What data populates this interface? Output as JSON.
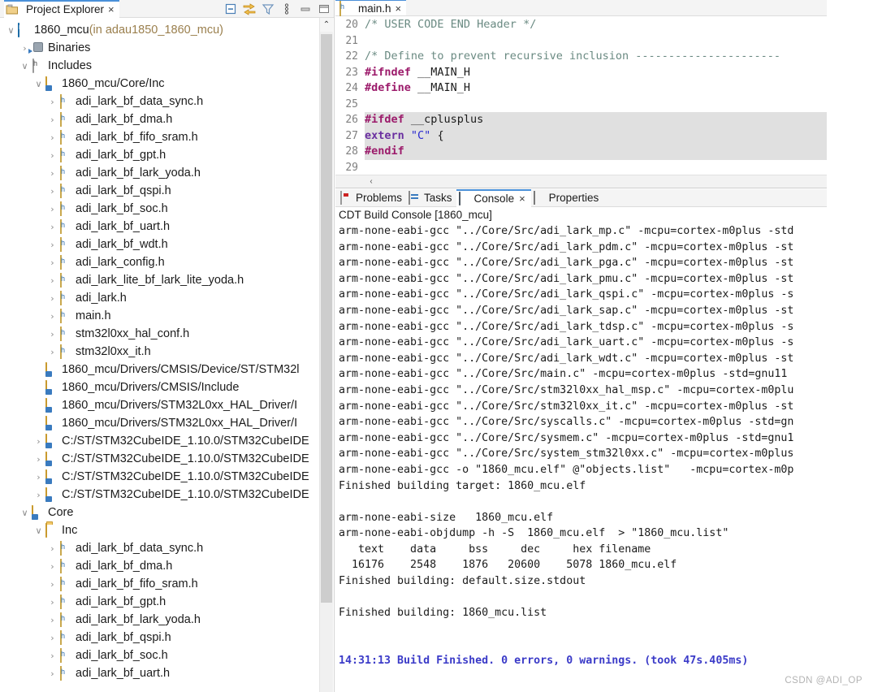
{
  "explorer": {
    "tab_label": "Project Explorer",
    "tab_close": "×",
    "toolbar": [
      {
        "name": "collapse-all-icon",
        "title": "Collapse All"
      },
      {
        "name": "link-with-editor-icon",
        "title": "Link with Editor"
      },
      {
        "name": "filter-icon",
        "title": "Filters"
      },
      {
        "name": "view-menu-icon",
        "title": "View Menu"
      },
      {
        "name": "minimize-icon",
        "title": "Minimize"
      },
      {
        "name": "maximize-icon",
        "title": "Maximize"
      }
    ],
    "scroll_up_glyph": "⌃",
    "tree": [
      {
        "indent": 0,
        "twisty": "∨",
        "icon": "prj",
        "label": "1860_mcu",
        "suffix": " (in adau1850_1860_mcu)"
      },
      {
        "indent": 1,
        "twisty": "›",
        "icon": "bin",
        "label": "Binaries",
        "suffix": ""
      },
      {
        "indent": 1,
        "twisty": "∨",
        "icon": "inc",
        "label": "Includes",
        "suffix": ""
      },
      {
        "indent": 2,
        "twisty": "∨",
        "icon": "src",
        "label": "1860_mcu/Core/Inc",
        "suffix": ""
      },
      {
        "indent": 3,
        "twisty": "›",
        "icon": "h",
        "label": "adi_lark_bf_data_sync.h",
        "suffix": ""
      },
      {
        "indent": 3,
        "twisty": "›",
        "icon": "h",
        "label": "adi_lark_bf_dma.h",
        "suffix": ""
      },
      {
        "indent": 3,
        "twisty": "›",
        "icon": "h",
        "label": "adi_lark_bf_fifo_sram.h",
        "suffix": ""
      },
      {
        "indent": 3,
        "twisty": "›",
        "icon": "h",
        "label": "adi_lark_bf_gpt.h",
        "suffix": ""
      },
      {
        "indent": 3,
        "twisty": "›",
        "icon": "h",
        "label": "adi_lark_bf_lark_yoda.h",
        "suffix": ""
      },
      {
        "indent": 3,
        "twisty": "›",
        "icon": "h",
        "label": "adi_lark_bf_qspi.h",
        "suffix": ""
      },
      {
        "indent": 3,
        "twisty": "›",
        "icon": "h",
        "label": "adi_lark_bf_soc.h",
        "suffix": ""
      },
      {
        "indent": 3,
        "twisty": "›",
        "icon": "h",
        "label": "adi_lark_bf_uart.h",
        "suffix": ""
      },
      {
        "indent": 3,
        "twisty": "›",
        "icon": "h",
        "label": "adi_lark_bf_wdt.h",
        "suffix": ""
      },
      {
        "indent": 3,
        "twisty": "›",
        "icon": "h",
        "label": "adi_lark_config.h",
        "suffix": ""
      },
      {
        "indent": 3,
        "twisty": "›",
        "icon": "h",
        "label": "adi_lark_lite_bf_lark_lite_yoda.h",
        "suffix": ""
      },
      {
        "indent": 3,
        "twisty": "›",
        "icon": "h",
        "label": "adi_lark.h",
        "suffix": ""
      },
      {
        "indent": 3,
        "twisty": "›",
        "icon": "h",
        "label": "main.h",
        "suffix": ""
      },
      {
        "indent": 3,
        "twisty": "›",
        "icon": "h",
        "label": "stm32l0xx_hal_conf.h",
        "suffix": ""
      },
      {
        "indent": 3,
        "twisty": "›",
        "icon": "h",
        "label": "stm32l0xx_it.h",
        "suffix": ""
      },
      {
        "indent": 2,
        "twisty": "",
        "icon": "src",
        "label": "1860_mcu/Drivers/CMSIS/Device/ST/STM32l",
        "suffix": ""
      },
      {
        "indent": 2,
        "twisty": "",
        "icon": "src",
        "label": "1860_mcu/Drivers/CMSIS/Include",
        "suffix": ""
      },
      {
        "indent": 2,
        "twisty": "",
        "icon": "src",
        "label": "1860_mcu/Drivers/STM32L0xx_HAL_Driver/I",
        "suffix": ""
      },
      {
        "indent": 2,
        "twisty": "",
        "icon": "src",
        "label": "1860_mcu/Drivers/STM32L0xx_HAL_Driver/I",
        "suffix": ""
      },
      {
        "indent": 2,
        "twisty": "›",
        "icon": "src",
        "label": "C:/ST/STM32CubeIDE_1.10.0/STM32CubeIDE",
        "suffix": ""
      },
      {
        "indent": 2,
        "twisty": "›",
        "icon": "src",
        "label": "C:/ST/STM32CubeIDE_1.10.0/STM32CubeIDE",
        "suffix": ""
      },
      {
        "indent": 2,
        "twisty": "›",
        "icon": "src",
        "label": "C:/ST/STM32CubeIDE_1.10.0/STM32CubeIDE",
        "suffix": ""
      },
      {
        "indent": 2,
        "twisty": "›",
        "icon": "src",
        "label": "C:/ST/STM32CubeIDE_1.10.0/STM32CubeIDE",
        "suffix": ""
      },
      {
        "indent": 1,
        "twisty": "∨",
        "icon": "src",
        "label": "Core",
        "suffix": ""
      },
      {
        "indent": 2,
        "twisty": "∨",
        "icon": "folder",
        "label": "Inc",
        "suffix": ""
      },
      {
        "indent": 3,
        "twisty": "›",
        "icon": "h",
        "label": "adi_lark_bf_data_sync.h",
        "suffix": ""
      },
      {
        "indent": 3,
        "twisty": "›",
        "icon": "h",
        "label": "adi_lark_bf_dma.h",
        "suffix": ""
      },
      {
        "indent": 3,
        "twisty": "›",
        "icon": "h",
        "label": "adi_lark_bf_fifo_sram.h",
        "suffix": ""
      },
      {
        "indent": 3,
        "twisty": "›",
        "icon": "h",
        "label": "adi_lark_bf_gpt.h",
        "suffix": ""
      },
      {
        "indent": 3,
        "twisty": "›",
        "icon": "h",
        "label": "adi_lark_bf_lark_yoda.h",
        "suffix": ""
      },
      {
        "indent": 3,
        "twisty": "›",
        "icon": "h",
        "label": "adi_lark_bf_qspi.h",
        "suffix": ""
      },
      {
        "indent": 3,
        "twisty": "›",
        "icon": "h",
        "label": "adi_lark_bf_soc.h",
        "suffix": ""
      },
      {
        "indent": 3,
        "twisty": "›",
        "icon": "h",
        "label": "adi_lark_bf_uart.h",
        "suffix": ""
      }
    ]
  },
  "editor": {
    "tab_label": "main.h",
    "tab_close": "×",
    "hscroll_arrow": "‹",
    "lines": [
      {
        "no": "20",
        "hl": false,
        "parts": [
          {
            "t": "/* USER CODE END Header */",
            "c": "c-comment"
          }
        ]
      },
      {
        "no": "21",
        "hl": false,
        "parts": []
      },
      {
        "no": "22",
        "hl": false,
        "parts": [
          {
            "t": "/* Define to prevent recursive inclusion ----------------------",
            "c": "c-comment"
          }
        ]
      },
      {
        "no": "23",
        "hl": false,
        "parts": [
          {
            "t": "#ifndef",
            "c": "c-pp"
          },
          {
            "t": " __MAIN_H",
            "c": "ctext"
          }
        ]
      },
      {
        "no": "24",
        "hl": false,
        "parts": [
          {
            "t": "#define",
            "c": "c-pp"
          },
          {
            "t": " __MAIN_H",
            "c": "ctext"
          }
        ]
      },
      {
        "no": "25",
        "hl": false,
        "parts": []
      },
      {
        "no": "26",
        "hl": true,
        "parts": [
          {
            "t": "#ifdef",
            "c": "c-pp"
          },
          {
            "t": " __cplusplus",
            "c": "ctext"
          }
        ]
      },
      {
        "no": "27",
        "hl": true,
        "parts": [
          {
            "t": "extern",
            "c": "c-kw"
          },
          {
            "t": " ",
            "c": "ctext"
          },
          {
            "t": "\"C\"",
            "c": "c-str"
          },
          {
            "t": " {",
            "c": "ctext"
          }
        ]
      },
      {
        "no": "28",
        "hl": true,
        "parts": [
          {
            "t": "#endif",
            "c": "c-pp"
          }
        ]
      },
      {
        "no": "29",
        "hl": false,
        "parts": []
      }
    ]
  },
  "console": {
    "tabs": [
      {
        "label": "Problems",
        "icon": "problems-icon",
        "active": false,
        "close": ""
      },
      {
        "label": "Tasks",
        "icon": "tasks-icon",
        "active": false,
        "close": ""
      },
      {
        "label": "Console",
        "icon": "console-icon",
        "active": true,
        "close": "×"
      },
      {
        "label": "Properties",
        "icon": "properties-icon",
        "active": false,
        "close": ""
      }
    ],
    "title": "CDT Build Console [1860_mcu]",
    "output": [
      {
        "text": "arm-none-eabi-gcc \"../Core/Src/adi_lark_mp.c\" -mcpu=cortex-m0plus -std",
        "style": "plain"
      },
      {
        "text": "arm-none-eabi-gcc \"../Core/Src/adi_lark_pdm.c\" -mcpu=cortex-m0plus -st",
        "style": "plain"
      },
      {
        "text": "arm-none-eabi-gcc \"../Core/Src/adi_lark_pga.c\" -mcpu=cortex-m0plus -st",
        "style": "plain"
      },
      {
        "text": "arm-none-eabi-gcc \"../Core/Src/adi_lark_pmu.c\" -mcpu=cortex-m0plus -st",
        "style": "plain"
      },
      {
        "text": "arm-none-eabi-gcc \"../Core/Src/adi_lark_qspi.c\" -mcpu=cortex-m0plus -s",
        "style": "plain"
      },
      {
        "text": "arm-none-eabi-gcc \"../Core/Src/adi_lark_sap.c\" -mcpu=cortex-m0plus -st",
        "style": "plain"
      },
      {
        "text": "arm-none-eabi-gcc \"../Core/Src/adi_lark_tdsp.c\" -mcpu=cortex-m0plus -s",
        "style": "plain"
      },
      {
        "text": "arm-none-eabi-gcc \"../Core/Src/adi_lark_uart.c\" -mcpu=cortex-m0plus -s",
        "style": "plain"
      },
      {
        "text": "arm-none-eabi-gcc \"../Core/Src/adi_lark_wdt.c\" -mcpu=cortex-m0plus -st",
        "style": "plain"
      },
      {
        "text": "arm-none-eabi-gcc \"../Core/Src/main.c\" -mcpu=cortex-m0plus -std=gnu11",
        "style": "plain"
      },
      {
        "text": "arm-none-eabi-gcc \"../Core/Src/stm32l0xx_hal_msp.c\" -mcpu=cortex-m0plu",
        "style": "plain"
      },
      {
        "text": "arm-none-eabi-gcc \"../Core/Src/stm32l0xx_it.c\" -mcpu=cortex-m0plus -st",
        "style": "plain"
      },
      {
        "text": "arm-none-eabi-gcc \"../Core/Src/syscalls.c\" -mcpu=cortex-m0plus -std=gn",
        "style": "plain"
      },
      {
        "text": "arm-none-eabi-gcc \"../Core/Src/sysmem.c\" -mcpu=cortex-m0plus -std=gnu1",
        "style": "plain"
      },
      {
        "text": "arm-none-eabi-gcc \"../Core/Src/system_stm32l0xx.c\" -mcpu=cortex-m0plus",
        "style": "plain"
      },
      {
        "text": "arm-none-eabi-gcc -o \"1860_mcu.elf\" @\"objects.list\"   -mcpu=cortex-m0p",
        "style": "plain"
      },
      {
        "text": "Finished building target: 1860_mcu.elf",
        "style": "plain"
      },
      {
        "text": "",
        "style": "plain"
      },
      {
        "text": "arm-none-eabi-size   1860_mcu.elf",
        "style": "plain"
      },
      {
        "text": "arm-none-eabi-objdump -h -S  1860_mcu.elf  > \"1860_mcu.list\"",
        "style": "plain"
      },
      {
        "text": "   text    data     bss     dec     hex filename",
        "style": "plain"
      },
      {
        "text": "  16176    2548    1876   20600    5078 1860_mcu.elf",
        "style": "plain"
      },
      {
        "text": "Finished building: default.size.stdout",
        "style": "plain"
      },
      {
        "text": "",
        "style": "plain"
      },
      {
        "text": "Finished building: 1860_mcu.list",
        "style": "plain"
      },
      {
        "text": "",
        "style": "plain"
      },
      {
        "text": "",
        "style": "plain"
      },
      {
        "text": "14:31:13 Build Finished. 0 errors, 0 warnings. (took 47s.405ms)",
        "style": "blue"
      }
    ]
  },
  "watermark": "CSDN @ADI_OP",
  "colors": {
    "tab_accent": "#4a90d9",
    "panel_bg": "#f4f4f4",
    "code_highlight": "#e0e0e0",
    "preprocessor": "#9c1b6b",
    "keyword": "#6a2fa0",
    "string": "#2a2ad0",
    "comment": "#6a8a82",
    "console_success": "#3b3bc8",
    "project_suffix": "#9a7f4d"
  }
}
